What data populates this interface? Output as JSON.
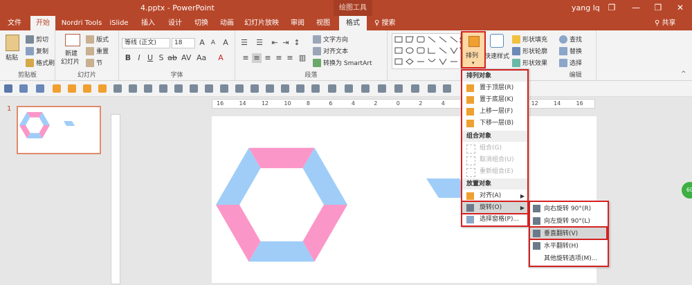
{
  "titlebar": {
    "doc_title": "4.pptx - PowerPoint",
    "context_tool": "绘图工具",
    "user": "yang lq",
    "min_icon": "minimize-icon",
    "restore_label": "❐",
    "minimize_label": "—",
    "maximize_label": "❒",
    "close_label": "✕"
  },
  "tabs": [
    "文件",
    "开始",
    "Nordri Tools",
    "iSlide",
    "插入",
    "设计",
    "切换",
    "动画",
    "幻灯片放映",
    "审阅",
    "视图",
    "格式"
  ],
  "search_label": "♀ 搜索",
  "share_label": "共享",
  "ribbon": {
    "clipboard": {
      "paste": "粘贴",
      "cut": "剪切",
      "copy": "复制",
      "format_painter": "格式刷",
      "label": "剪贴板"
    },
    "slides": {
      "new_slide": "新建",
      "new_slide2": "幻灯片",
      "layout": "版式",
      "reset": "重置",
      "section": "节",
      "label": "幻灯片"
    },
    "font": {
      "font_name": "等线 (正文)",
      "font_size": "18",
      "label": "字体"
    },
    "paragraph": {
      "text_direction": "文字方向",
      "align_text": "对齐文本",
      "convert_smartart": "转换为 SmartArt",
      "label": "段落"
    },
    "drawing": {
      "arrange": "排列",
      "quick_styles": "快速样式",
      "shape_fill": "形状填充",
      "shape_outline": "形状轮廓",
      "shape_effects": "形状效果"
    },
    "editing": {
      "find": "查找",
      "replace": "替换",
      "select": "选择",
      "label": "编辑"
    }
  },
  "slide_number": "1",
  "ruler_labels": [
    "16",
    "14",
    "12",
    "10",
    "8",
    "6",
    "4",
    "2",
    "0",
    "2",
    "4",
    "6",
    "8",
    "10",
    "12",
    "14",
    "16"
  ],
  "shapes": {
    "pink": "#fb96c8",
    "blue": "#9fcdf8"
  },
  "arrange_menu": {
    "sections": [
      {
        "header": "排列对象",
        "items": [
          {
            "label": "置于顶层(R)",
            "disabled": false
          },
          {
            "label": "置于底层(K)",
            "disabled": false
          },
          {
            "label": "上移一层(F)",
            "disabled": false
          },
          {
            "label": "下移一层(B)",
            "disabled": false
          }
        ]
      },
      {
        "header": "组合对象",
        "items": [
          {
            "label": "组合(G)",
            "disabled": true
          },
          {
            "label": "取消组合(U)",
            "disabled": true
          },
          {
            "label": "重新组合(E)",
            "disabled": true
          }
        ]
      },
      {
        "header": "放置对象",
        "items": [
          {
            "label": "对齐(A)",
            "disabled": false
          },
          {
            "label": "旋转(O)",
            "disabled": false
          },
          {
            "label": "选择窗格(P)...",
            "disabled": false
          }
        ]
      }
    ]
  },
  "rotate_submenu": [
    "向右旋转 90°(R)",
    "向左旋转 90°(L)",
    "垂直翻转(V)",
    "水平翻转(H)",
    "其他旋转选项(M)..."
  ],
  "badge": "60",
  "accent_color": "#b7472a"
}
